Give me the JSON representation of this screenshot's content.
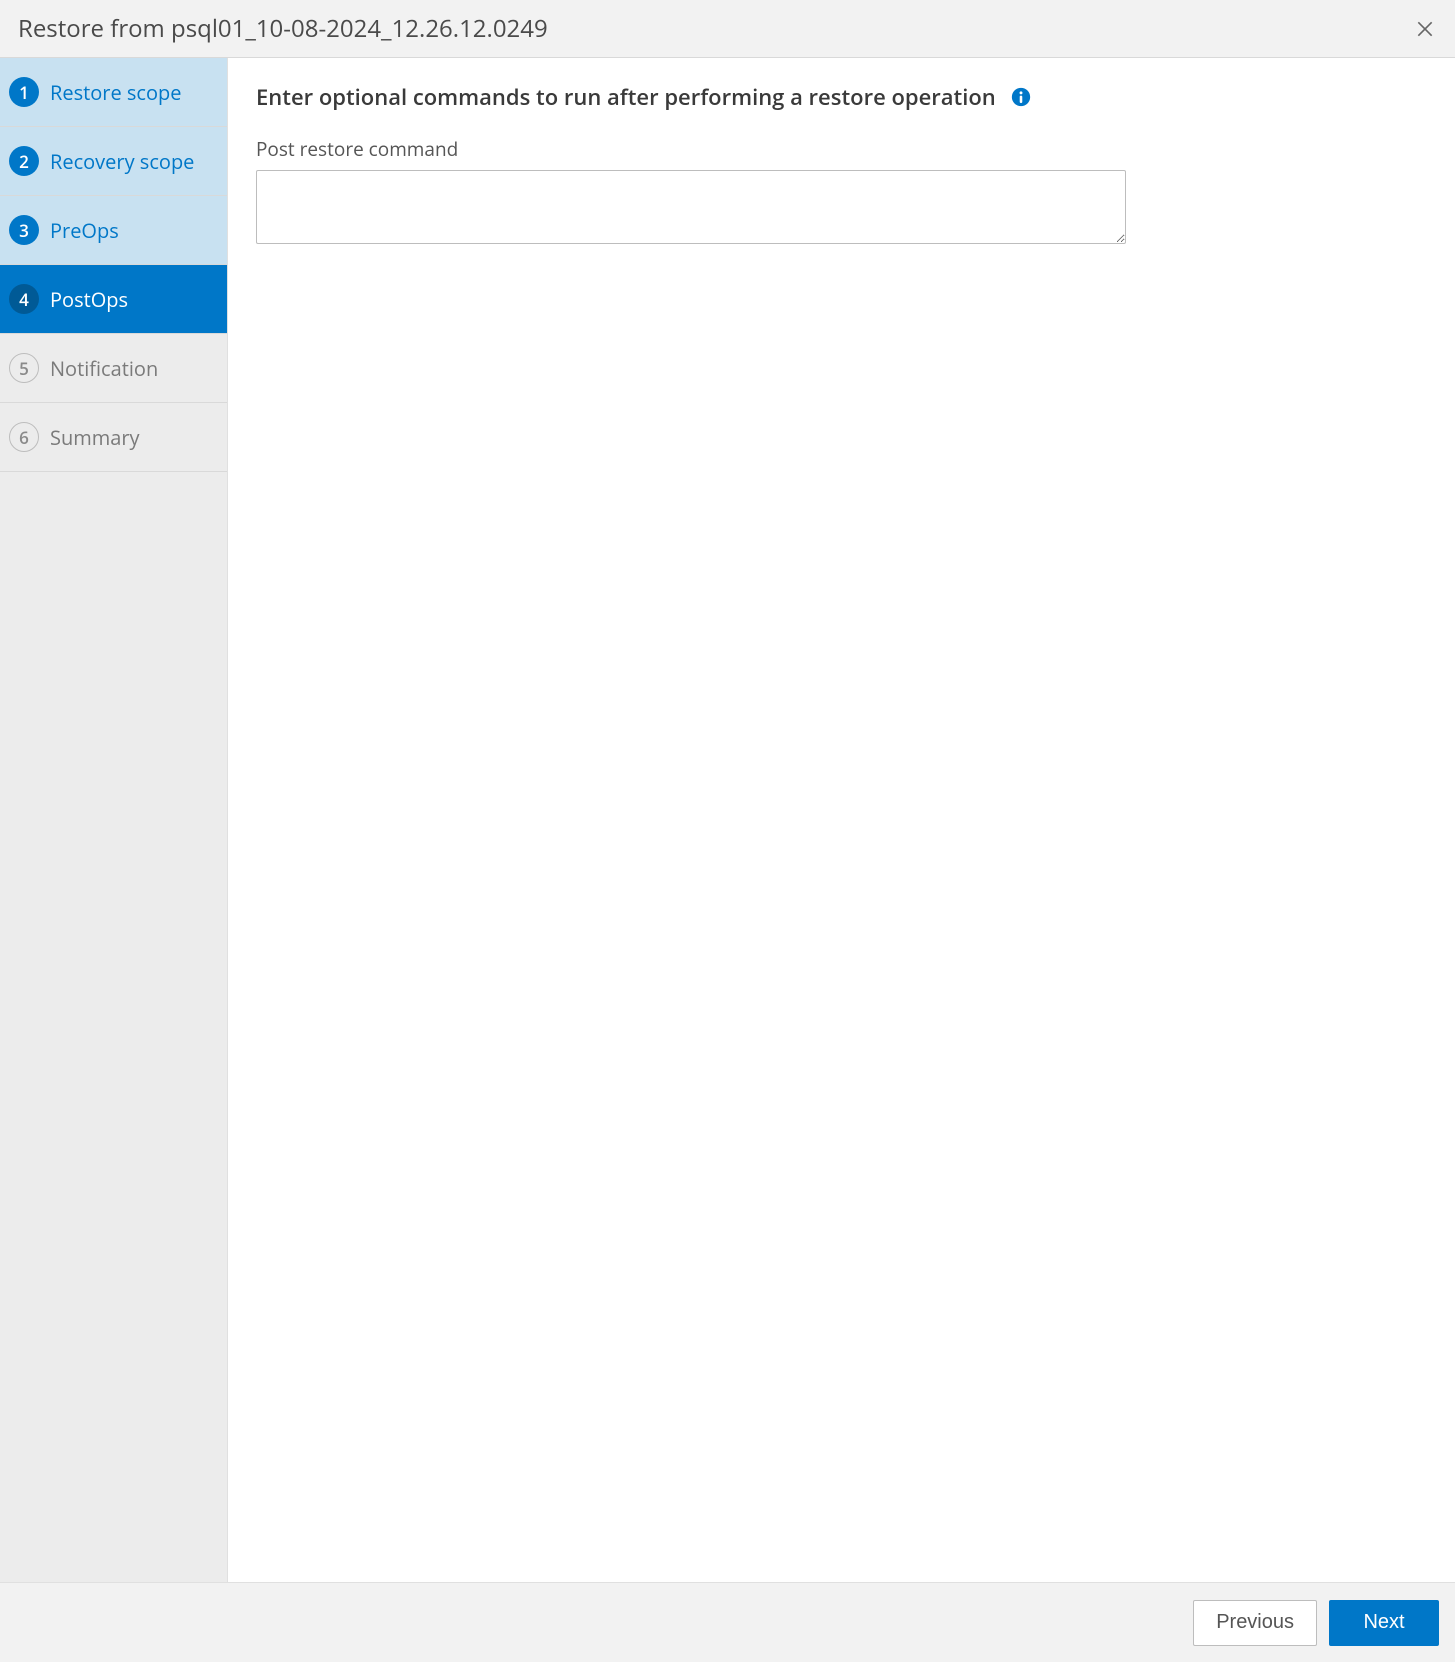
{
  "header": {
    "title": "Restore from psql01_10-08-2024_12.26.12.0249"
  },
  "sidebar": {
    "steps": [
      {
        "num": "1",
        "label": "Restore scope",
        "state": "completed"
      },
      {
        "num": "2",
        "label": "Recovery scope",
        "state": "completed"
      },
      {
        "num": "3",
        "label": "PreOps",
        "state": "completed"
      },
      {
        "num": "4",
        "label": "PostOps",
        "state": "current"
      },
      {
        "num": "5",
        "label": "Notification",
        "state": "upcoming"
      },
      {
        "num": "6",
        "label": "Summary",
        "state": "upcoming"
      }
    ]
  },
  "main": {
    "section_title": "Enter optional commands to run after performing a restore operation",
    "field_label": "Post restore command",
    "command_value": ""
  },
  "footer": {
    "previous_label": "Previous",
    "next_label": "Next"
  }
}
